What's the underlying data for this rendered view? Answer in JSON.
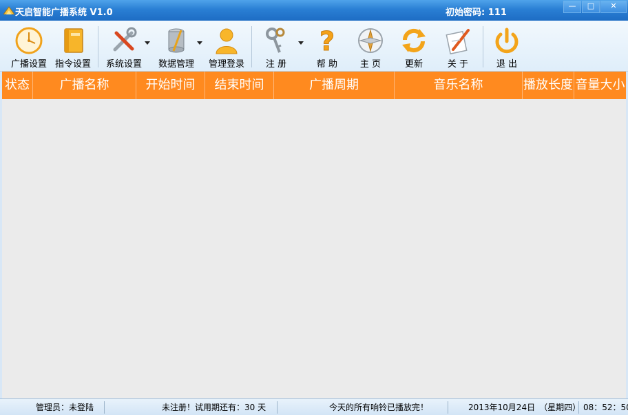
{
  "window": {
    "title": "天启智能广播系统 V1.0",
    "initial_password": "初始密码: 111",
    "controls": {
      "minimize": "—",
      "maximize": "□",
      "close": "✕"
    }
  },
  "toolbar": {
    "items": [
      {
        "label": "广播设置",
        "icon": "clock-icon"
      },
      {
        "label": "指令设置",
        "icon": "book-icon"
      },
      {
        "label": "系统设置",
        "icon": "tools-icon"
      },
      {
        "label": "数据管理",
        "icon": "database-icon"
      },
      {
        "label": "管理登录",
        "icon": "user-icon"
      },
      {
        "label": "注 册",
        "icon": "keys-icon"
      },
      {
        "label": "帮 助",
        "icon": "question-icon"
      },
      {
        "label": "主 页",
        "icon": "compass-icon"
      },
      {
        "label": "更新",
        "icon": "refresh-icon"
      },
      {
        "label": "关 于",
        "icon": "note-icon"
      },
      {
        "label": "退 出",
        "icon": "power-icon"
      }
    ]
  },
  "grid": {
    "columns": [
      "状态",
      "广播名称",
      "开始时间",
      "结束时间",
      "广播周期",
      "音乐名称",
      "播放长度",
      "音量大小"
    ],
    "rows": []
  },
  "status": {
    "admin": "管理员：未登陆",
    "trial": "未注册！试用期还有：30 天",
    "message": "今天的所有响铃已播放完！",
    "date": "2013年10月24日　（星期四）",
    "time": "08：52：50"
  },
  "colors": {
    "titlebar": "#2a7fd4",
    "header_orange": "#ff8a1f",
    "toolbar_bg": "#dfeefa"
  }
}
